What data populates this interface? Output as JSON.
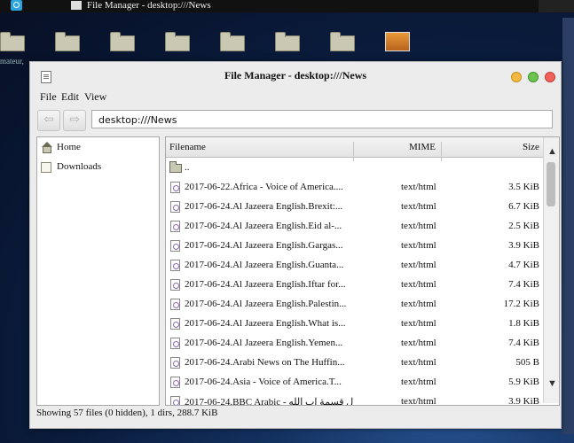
{
  "taskbar": {
    "window_title": "File Manager - desktop:///News"
  },
  "desktop": {
    "caption": "mateur,"
  },
  "window": {
    "title": "File Manager - desktop:///News",
    "menu": [
      "File",
      "Edit",
      "View"
    ],
    "back_glyph": "⇦",
    "forward_glyph": "⇨",
    "location": "desktop:///News",
    "sidebar": [
      {
        "label": "Home",
        "icon": "home-icon"
      },
      {
        "label": "Downloads",
        "icon": "folder-icon"
      }
    ],
    "columns": {
      "filename": "Filename",
      "mime": "MIME",
      "size": "Size"
    },
    "parent_dir": "..",
    "files": [
      {
        "name": "2017-06-22.Africa - Voice of America....",
        "mime": "text/html",
        "size": "3.5 KiB"
      },
      {
        "name": "2017-06-24.Al Jazeera English.Brexit:...",
        "mime": "text/html",
        "size": "6.7 KiB"
      },
      {
        "name": "2017-06-24.Al Jazeera English.Eid al-...",
        "mime": "text/html",
        "size": "2.5 KiB"
      },
      {
        "name": "2017-06-24.Al Jazeera English.Gargas...",
        "mime": "text/html",
        "size": "3.9 KiB"
      },
      {
        "name": "2017-06-24.Al Jazeera English.Guanta...",
        "mime": "text/html",
        "size": "4.7 KiB"
      },
      {
        "name": "2017-06-24.Al Jazeera English.Iftar for...",
        "mime": "text/html",
        "size": "7.4 KiB"
      },
      {
        "name": "2017-06-24.Al Jazeera English.Palestin...",
        "mime": "text/html",
        "size": "17.2 KiB"
      },
      {
        "name": "2017-06-24.Al Jazeera English.What is...",
        "mime": "text/html",
        "size": "1.8 KiB"
      },
      {
        "name": "2017-06-24.Al Jazeera English.Yemen...",
        "mime": "text/html",
        "size": "7.4 KiB"
      },
      {
        "name": "2017-06-24.Arabi News on The Huffin...",
        "mime": "text/html",
        "size": "505 B"
      },
      {
        "name": "2017-06-24.Asia - Voice of America.T...",
        "mime": "text/html",
        "size": "5.9 KiB"
      },
      {
        "name": "2017-06-24.BBC Arabic - ال قسمة اب الله",
        "mime": "text/html",
        "size": "3.9 KiB"
      }
    ],
    "status": "Showing 57 files (0 hidden), 1 dirs, 288.7 KiB"
  }
}
